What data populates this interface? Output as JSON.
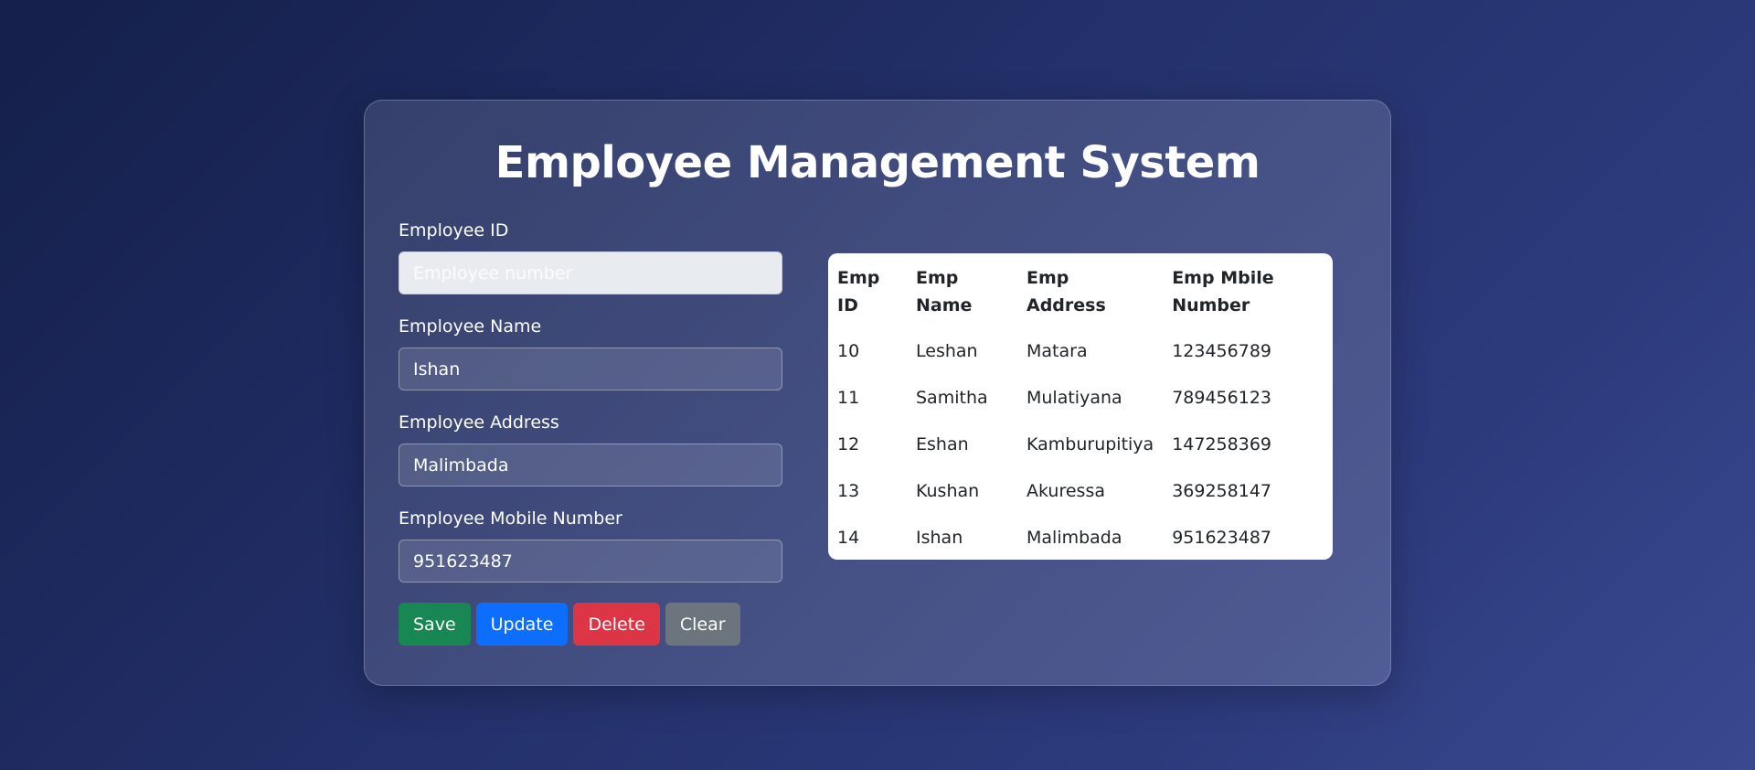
{
  "page": {
    "title": "Employee Management System"
  },
  "form": {
    "fields": [
      {
        "label": "Employee ID",
        "value": "",
        "placeholder": "Employee number"
      },
      {
        "label": "Employee Name",
        "value": "Ishan",
        "placeholder": ""
      },
      {
        "label": "Employee Address",
        "value": "Malimbada",
        "placeholder": ""
      },
      {
        "label": "Employee Mobile Number",
        "value": "951623487",
        "placeholder": ""
      }
    ],
    "buttons": {
      "save": "Save",
      "update": "Update",
      "delete": "Delete",
      "clear": "Clear"
    }
  },
  "table": {
    "headers": [
      "Emp ID",
      "Emp Name",
      "Emp Address",
      "Emp Mbile Number"
    ],
    "rows": [
      [
        "10",
        "Leshan",
        "Matara",
        "123456789"
      ],
      [
        "11",
        "Samitha",
        "Mulatiyana",
        "789456123"
      ],
      [
        "12",
        "Eshan",
        "Kamburupitiya",
        "147258369"
      ],
      [
        "13",
        "Kushan",
        "Akuressa",
        "369258147"
      ],
      [
        "14",
        "Ishan",
        "Malimbada",
        "951623487"
      ]
    ]
  },
  "colors": {
    "save": "#198754",
    "update": "#0d6efd",
    "delete": "#dc3545",
    "clear": "#6c757d"
  }
}
